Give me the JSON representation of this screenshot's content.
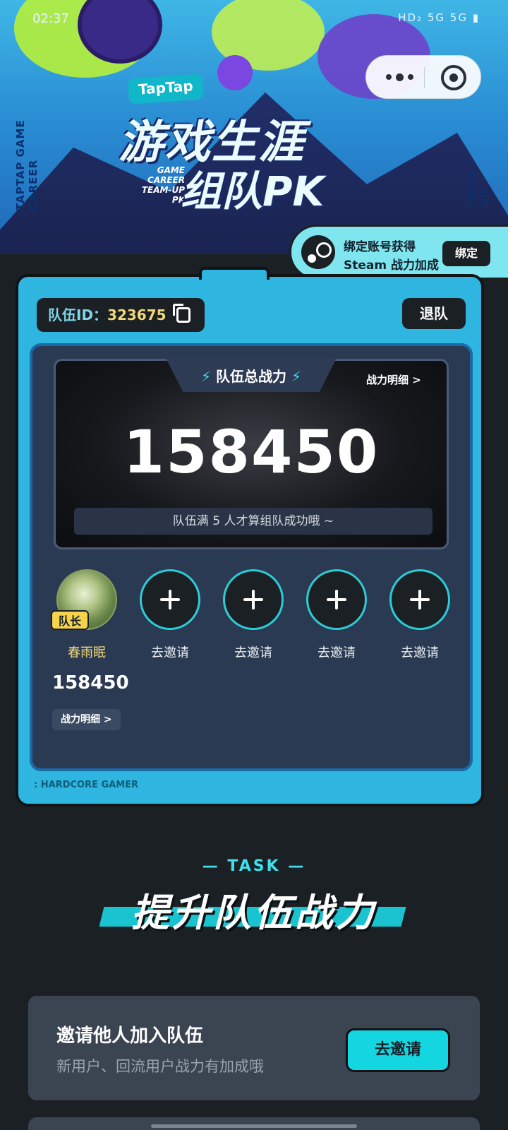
{
  "status_bar": {
    "time": "02:37",
    "icons": "HD₂ 5G 5G ▮"
  },
  "hero": {
    "logo": "TapTap",
    "title_line1": "游戏生涯",
    "title_line2": "组队PK",
    "small_text": "GAME CAREER TEAM-UP PK",
    "side_left": "TAPTAP GAME CAREER",
    "side_right": "TEAM-UP"
  },
  "steam_banner": {
    "line1": "绑定账号获得",
    "line2": "Steam 战力加成",
    "button": "绑定"
  },
  "team": {
    "id_label": "队伍ID：",
    "id_value": "323675",
    "quit_label": "退队",
    "power_title": "队伍总战力",
    "detail_link": "战力明细 >",
    "total_power": "158450",
    "hint": "队伍满 5 人才算组队成功哦 ~",
    "footer": ": HARDCORE GAMER",
    "members": [
      {
        "name": "春雨眠",
        "badge": "队长",
        "power": "158450",
        "detail": "战力明细 >"
      },
      {
        "name": "去邀请"
      },
      {
        "name": "去邀请"
      },
      {
        "name": "去邀请"
      },
      {
        "name": "去邀请"
      }
    ]
  },
  "task_section": {
    "kicker": "TASK",
    "title": "提升队伍战力",
    "tasks": [
      {
        "title": "邀请他人加入队伍",
        "desc": "新用户、回流用户战力有加成哦",
        "button": "去邀请"
      }
    ]
  }
}
